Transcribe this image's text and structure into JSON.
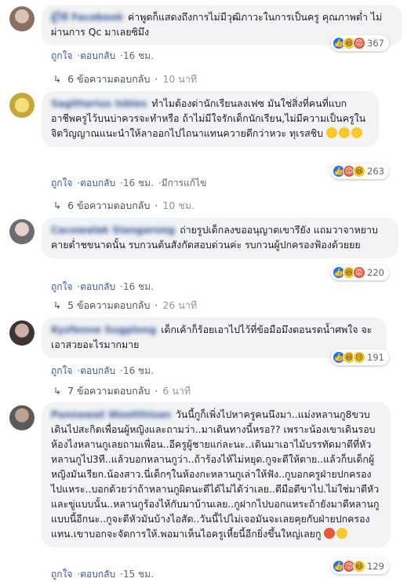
{
  "colors": {
    "link": "#385898",
    "bubble": "#f2f3f5",
    "like": "#1877f2",
    "haha": "#f7c92f",
    "angry": "#e9573f"
  },
  "labels": {
    "like": "ถูกใจ",
    "reply": "ตอบกลับ",
    "edited": "มีการแก้ไข",
    "dot": "·"
  },
  "comments": [
    {
      "author": "ผู้ใช้ Facebook",
      "text": "ค่าพูดก็แสดงถึงการไม่มีวุฒิภาวะในการเป็นครู คุณภาพต่ำ ไม่ผ่านการ Qc มาเลยซิมึง",
      "time": "16 ชม.",
      "reactions": [
        "like-icon",
        "haha-icon",
        "angry-icon"
      ],
      "reaction_count": "367",
      "replies_text": "6 ข้อความตอบกลับ",
      "replies_time": "10 นาที"
    },
    {
      "author": "Sagittarius Isbles",
      "text": "ทำไมต้องด่านักเรียนลงเฟซ มันใช่สิ่งที่คนที่แบกอาชีพครูไว้บนบ่าควรจะทำหรือ ถ้าไม่มีใจรักเด็กนักเรียน,ไม่มีความเป็นครูในจิตวิญญาณแนะนำให้ลาออกไปไถนาแทนควายดีกว่าหวะ ทุเรสชิบ",
      "time": "16 ชม.",
      "edited": true,
      "reactions": [
        "like-icon",
        "angry-icon",
        "haha-icon"
      ],
      "reaction_count": "263",
      "replies_text": "6 ข้อความตอบกลับ",
      "replies_time": "10 ชม."
    },
    {
      "author": "Cacowalak Siangarong",
      "text": "ถ่ายรูปเด็กลงขออนุญาตเขารึยัง แถมวาจาหยาบคายต่ำชขนาดนั้น รบกวนต้นสังกัดสอบด่วนค่ะ รบกวนผู้ปกครองฟ้องด้วยยย",
      "time": "16 ชม.",
      "reactions": [
        "like-icon",
        "haha-icon",
        "angry-icon"
      ],
      "reaction_count": "220",
      "replies_text": "5 ข้อความตอบกลับ",
      "replies_time": "26 นาที"
    },
    {
      "author": "Kyzfenne Sugplong",
      "text": "เด็กเค้าก็ร้อยเอาไปไว้ที่ข้อมือมึงตอนรดน้ำศพใจ จะเอาสวยอะไรมากมาย",
      "time": "16 ชม.",
      "reactions": [
        "like-icon",
        "haha-icon",
        "sad-icon"
      ],
      "reaction_count": "191",
      "replies_text": "7 ข้อความตอบกลับ",
      "replies_time": "6 นาที"
    },
    {
      "author": "Pannawat Wootthisan",
      "text": "วันนี้กูก็เพิ่งไปหาครูคนนึงมา..แม่งหลานกู8ขวบเดินไปสะกิดเพื่อนผู้หญิงและถามว่า..มาเดินทางนี้หรอ?? เพราะน้องเขาเดินรอบห้องไงหลานกูเลยถามเพื่อน..อีครูผู้ชายแก่ละนะ..เดินมาเอาไม้บรรทัดมาตีที่หัวหลานกูไป3ที..แล้วบอกหลานกูว่า..ถ้าร้องไห้ไม่หยุด.กูจะตีให้ตาย..แล้วก็บเด็กผู้หญิงมันเรียก.น้องสาว.นี่เด็กๆในห้องกะหลานกูเล่าให้ฟัง..กูบอกครูฝ่ายปกครองไปแหระ..บอกด้วยว่าถ้าหลานกูผิดนะตีได้ไม่ได้ว่าเลย..ตีมือตีขาไป.ไม่ใช่มาตีหัวและขู่แบบนั้น..หลานกูร้องไห้กับมาบ้านเลย..กูฝากไปบอกแหระถ้ายังมาตีหลานกูแบบนี้อีกนะ..กูจะตีหัวมันบ้างไอสัด..วันนี้ไปไม่เจอมันจะเลยคุยกับฝ่ายปกครองแทน.เขาบอกจะจัดการให้.พอมาเห็นไอครูเหี้ยนี้อีกยิ่งขึ้นใหญ่เลยกู",
      "time": "15 ชม.",
      "reactions": [
        "like-icon",
        "angry-icon",
        "haha-icon"
      ],
      "reaction_count": "129"
    }
  ]
}
